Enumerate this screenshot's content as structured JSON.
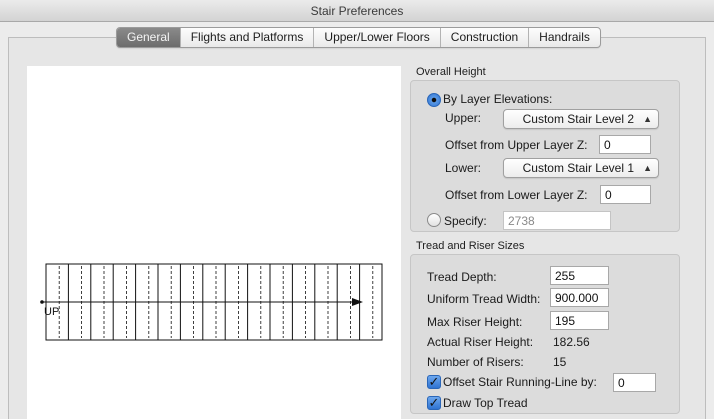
{
  "window": {
    "title": "Stair Preferences"
  },
  "tabs": [
    {
      "label": "General",
      "active": true
    },
    {
      "label": "Flights and Platforms",
      "active": false
    },
    {
      "label": "Upper/Lower Floors",
      "active": false
    },
    {
      "label": "Construction",
      "active": false
    },
    {
      "label": "Handrails",
      "active": false
    }
  ],
  "preview": {
    "up_label": "UP"
  },
  "overall_height": {
    "title": "Overall Height",
    "by_layer_label": "By Layer Elevations:",
    "by_layer_selected": true,
    "upper_label": "Upper:",
    "upper_value": "Custom Stair Level 2",
    "offset_upper_label": "Offset from Upper Layer Z:",
    "offset_upper_value": "0",
    "lower_label": "Lower:",
    "lower_value": "Custom Stair Level 1",
    "offset_lower_label": "Offset from Lower Layer Z:",
    "offset_lower_value": "0",
    "specify_label": "Specify:",
    "specify_selected": false,
    "specify_value": "2738"
  },
  "tread_riser": {
    "title": "Tread and Riser Sizes",
    "tread_depth_label": "Tread Depth:",
    "tread_depth_value": "255",
    "uniform_width_label": "Uniform Tread Width:",
    "uniform_width_value": "900.000",
    "max_riser_label": "Max Riser Height:",
    "max_riser_value": "195",
    "actual_riser_label": "Actual Riser Height:",
    "actual_riser_value": "182.56",
    "num_risers_label": "Number of Risers:",
    "num_risers_value": "15",
    "offset_running_label": "Offset Stair Running-Line by:",
    "offset_running_checked": true,
    "offset_running_value": "0",
    "draw_top_tread_label": "Draw Top Tread",
    "draw_top_tread_checked": true
  },
  "colors": {
    "accent": "#2f73d1",
    "tab_active": "#7a7a7a"
  }
}
